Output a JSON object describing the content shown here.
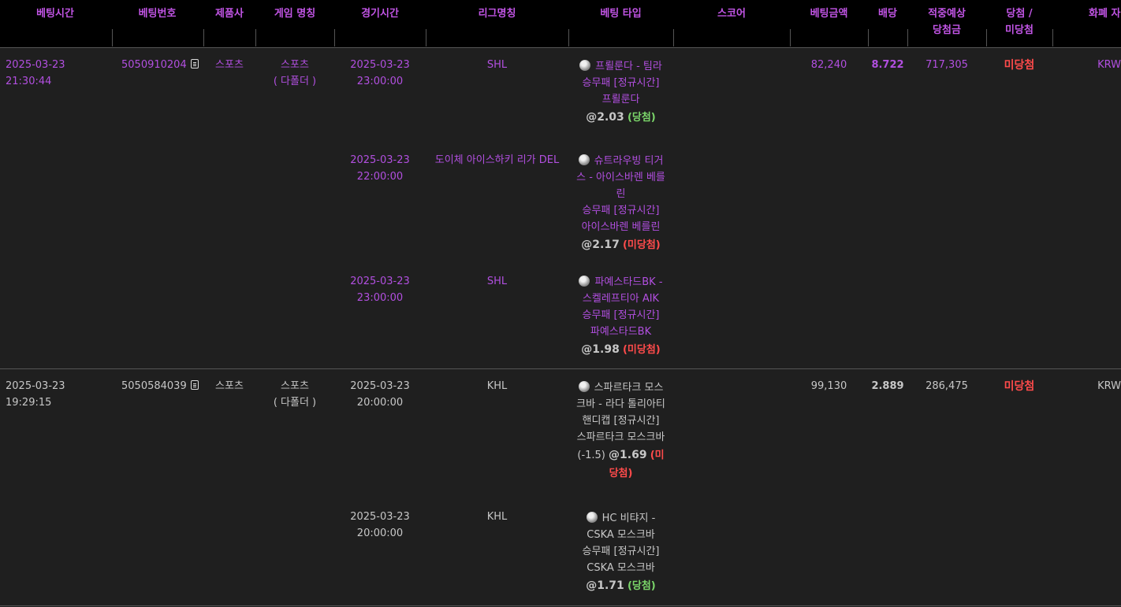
{
  "headers": {
    "bet_time": "베팅시간",
    "bet_no": "베팅번호",
    "provider": "제품사",
    "game_name": "게임 명칭",
    "game_time": "경기시간",
    "league": "리그명칭",
    "bet_type": "베팅 타입",
    "score": "스코어",
    "bet_amount": "베팅금액",
    "odds": "배당",
    "expected_line1": "적중예상",
    "expected_line2": "당첨금",
    "result_line1": "당첨 /",
    "result_line2": "미당첨",
    "currency": "화폐 자"
  },
  "bets": [
    {
      "time": "2025-03-23 21:30:44",
      "no": "5050910204",
      "provider": "스포츠",
      "game": "스포츠",
      "game_sub": "( 다폴더 )",
      "amount": "82,240",
      "odds": "8.722",
      "expected": "717,305",
      "result": "미당첨",
      "currency": "KRW",
      "legs": [
        {
          "gtime_date": "2025-03-23",
          "gtime_clock": "23:00:00",
          "league": "SHL",
          "type_lines": [
            "프뢸룬다 - 팀라",
            "승무패 [정규시간]",
            "프뢸룬다"
          ],
          "odds": "@2.03",
          "outcome": "(당첨)",
          "win": true
        },
        {
          "gtime_date": "2025-03-23",
          "gtime_clock": "22:00:00",
          "league": "도이체 아이스하키 리가 DEL",
          "type_lines": [
            "슈트라우빙 티거",
            "스 - 아이스바렌 베를",
            "린",
            "승무패 [정규시간]",
            "아이스바렌 베를린"
          ],
          "odds": "@2.17",
          "outcome": "(미당첨)",
          "win": false
        },
        {
          "gtime_date": "2025-03-23",
          "gtime_clock": "23:00:00",
          "league": "SHL",
          "type_lines": [
            "파예스타드BK -",
            "스켈레프티아 AIK",
            "승무패 [정규시간]",
            "파예스타드BK"
          ],
          "odds": "@1.98",
          "outcome": "(미당첨)",
          "win": false
        }
      ]
    },
    {
      "time": "2025-03-23 19:29:15",
      "no": "5050584039",
      "provider": "스포츠",
      "game": "스포츠",
      "game_sub": "( 다폴더 )",
      "amount": "99,130",
      "odds": "2.889",
      "expected": "286,475",
      "result": "미당첨",
      "currency": "KRW",
      "legs": [
        {
          "gtime_date": "2025-03-23",
          "gtime_clock": "20:00:00",
          "league": "KHL",
          "type_lines": [
            "스파르타크 모스",
            "크바 - 라다 톨리아티",
            "핸디캡 [정규시간]",
            "스파르타크 모스크바"
          ],
          "handicap": "(-1.5)",
          "odds": "@1.69",
          "outcome_a": "(미",
          "outcome_b": "당첨)",
          "win": false
        },
        {
          "gtime_date": "2025-03-23",
          "gtime_clock": "20:00:00",
          "league": "KHL",
          "type_lines": [
            "HC 비탸지 -",
            "CSKA 모스크바",
            "승무패 [정규시간]",
            "CSKA 모스크바"
          ],
          "odds": "@1.71",
          "outcome": "(당첨)",
          "win": true
        }
      ]
    }
  ]
}
